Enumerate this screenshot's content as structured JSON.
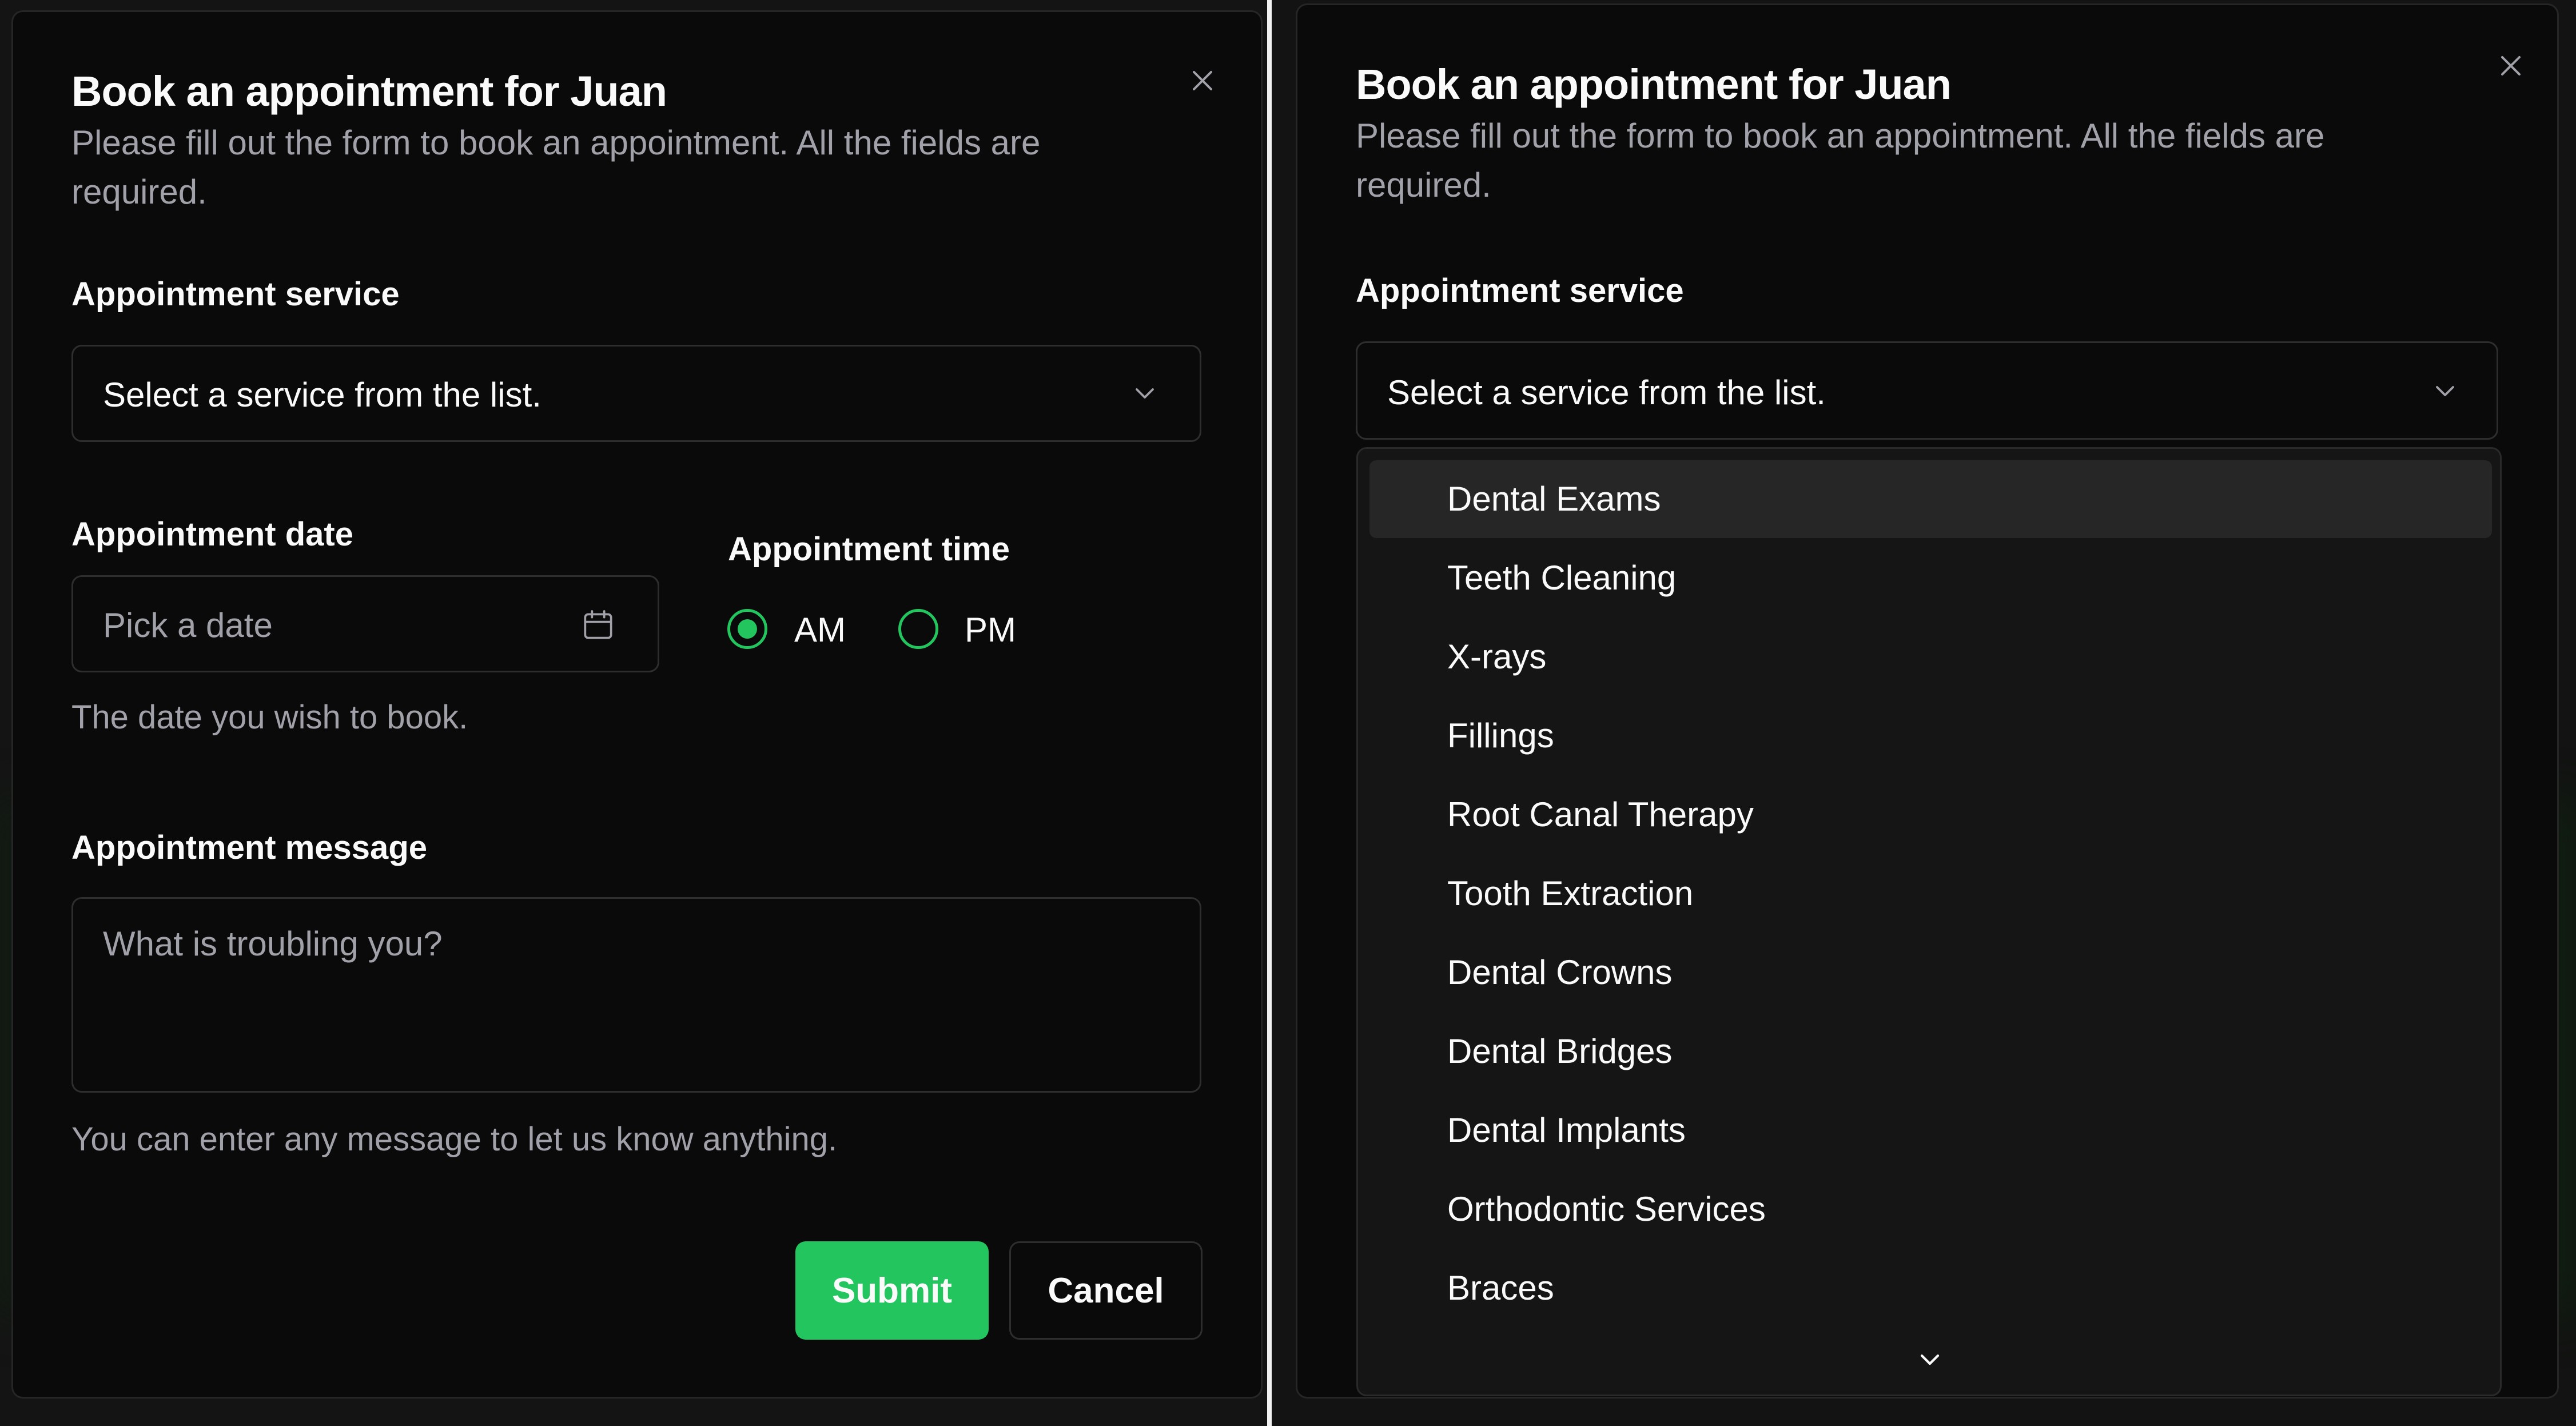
{
  "panels": [
    {
      "dialog": {
        "title": "Book an appointment for Juan",
        "description": "Please fill out the form to book an appointment. All the fields are required."
      },
      "service": {
        "label": "Appointment service",
        "selected": "Select a service from the list."
      },
      "date": {
        "label": "Appointment date",
        "placeholder": "Pick a date",
        "hint": "The date you wish to book."
      },
      "time": {
        "label": "Appointment time",
        "options": [
          {
            "label": "AM",
            "selected": true
          },
          {
            "label": "PM",
            "selected": false
          }
        ]
      },
      "message": {
        "label": "Appointment message",
        "placeholder": "What is troubling you?",
        "hint": "You can enter any message to let us know anything."
      },
      "buttons": {
        "submit": "Submit",
        "cancel": "Cancel"
      }
    },
    {
      "dialog": {
        "title": "Book an appointment for Juan",
        "description": "Please fill out the form to book an appointment. All the fields are required."
      },
      "service": {
        "label": "Appointment service",
        "selected": "Select a service from the list.",
        "open": true,
        "highlighted": "Dental Exams",
        "options": [
          "Dental Exams",
          "Teeth Cleaning",
          "X-rays",
          "Fillings",
          "Root Canal Therapy",
          "Tooth Extraction",
          "Dental Crowns",
          "Dental Bridges",
          "Dental Implants",
          "Orthodontic Services",
          "Braces"
        ]
      }
    }
  ],
  "icons": {
    "close": "close-icon",
    "chevron": "chevron-down-icon",
    "calendar": "calendar-icon"
  },
  "colors": {
    "accent": "#22c55e",
    "dialog_bg": "#0a0a0a",
    "text": "#fafafa",
    "muted": "#a1a1aa",
    "border": "#2e2e2e",
    "highlight": "#262626"
  }
}
